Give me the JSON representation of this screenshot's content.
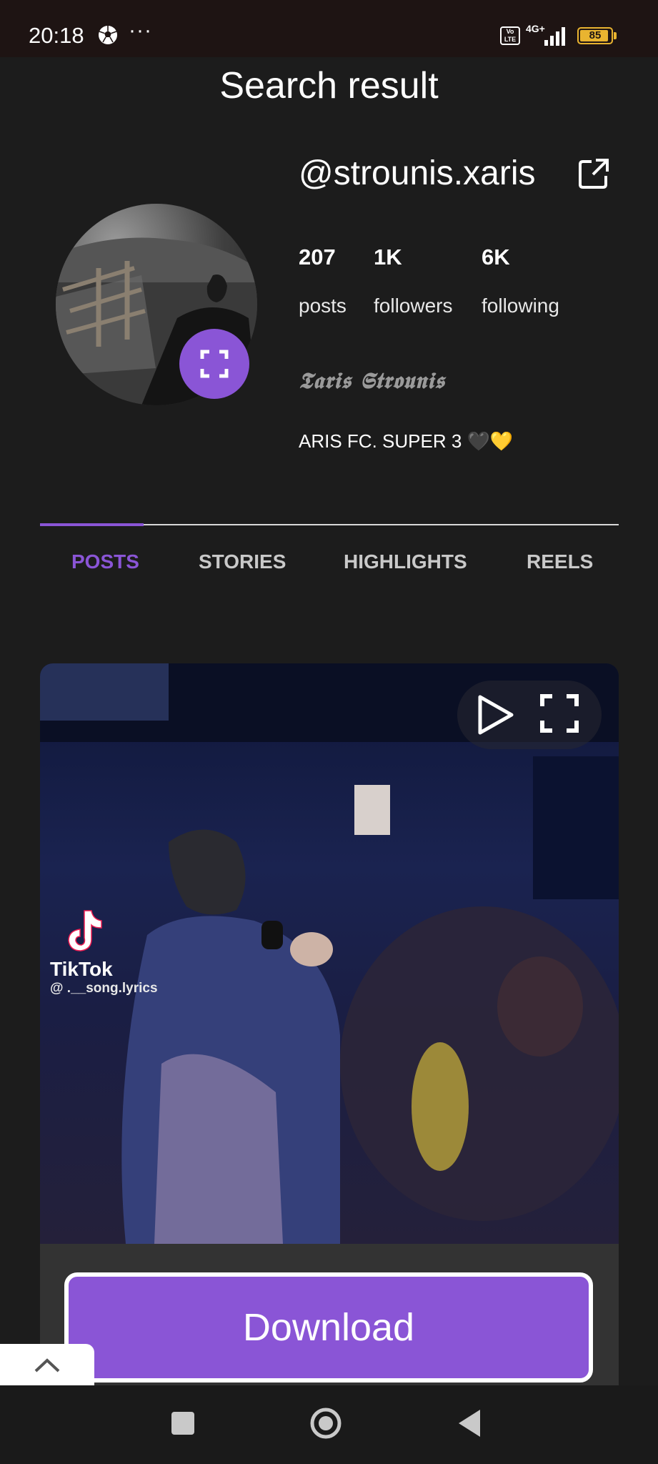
{
  "status_bar": {
    "time": "20:18",
    "overflow": "···",
    "volte": "Vo LTE",
    "network": "4G+",
    "battery": "85",
    "icons": [
      "soccer-ball-icon",
      "volte-icon",
      "signal-icon",
      "battery-icon"
    ]
  },
  "page": {
    "title": "Search result"
  },
  "profile": {
    "username": "@strounis.xaris",
    "stats": [
      {
        "value": "207",
        "label": "posts"
      },
      {
        "value": "1K",
        "label": "followers"
      },
      {
        "value": "6K",
        "label": "following"
      }
    ],
    "display_name": "𝕿𝖆𝖗𝖎𝖘 𝕾𝖙𝖗𝖔𝖚𝖓𝖎𝖘",
    "bio": "ARIS FC. SUPER 3 🖤💛"
  },
  "tabs": [
    {
      "label": "POSTS",
      "active": true
    },
    {
      "label": "STORIES",
      "active": false
    },
    {
      "label": "HIGHLIGHTS",
      "active": false
    },
    {
      "label": "REELS",
      "active": false
    }
  ],
  "media": {
    "watermark_brand": "TikTok",
    "watermark_handle": "@ .__song.lyrics"
  },
  "actions": {
    "download_label": "Download"
  },
  "colors": {
    "accent": "#8a55d6",
    "background": "#1c1c1c",
    "status_bar": "#1e1413",
    "battery": "#e9b430"
  }
}
